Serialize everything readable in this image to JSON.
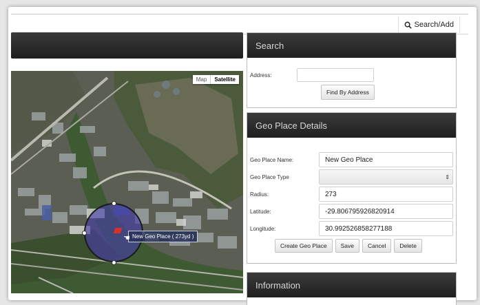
{
  "toolbar": {
    "search_add_label": "Search/Add"
  },
  "map": {
    "type_options": [
      "Map",
      "Satellite"
    ],
    "selected_type": "Satellite",
    "place_label": "New Geo Place ( 273yd )"
  },
  "search_panel": {
    "title": "Search",
    "address_label": "Address:",
    "address_value": "",
    "find_button": "Find By Address"
  },
  "details_panel": {
    "title": "Geo Place Details",
    "name_label": "Geo Place Name:",
    "name_value": "New Geo Place",
    "type_label": "Geo Place Type",
    "type_value": "",
    "radius_label": "Radius:",
    "radius_value": "273",
    "latitude_label": "Latitude:",
    "latitude_value": "-29.806795926820914",
    "longitude_label": "Longitude:",
    "longitude_value": "30.992526858277188",
    "buttons": {
      "create": "Create Geo Place",
      "save": "Save",
      "cancel": "Cancel",
      "delete": "Delete"
    }
  },
  "info_panel": {
    "title": "Information"
  }
}
